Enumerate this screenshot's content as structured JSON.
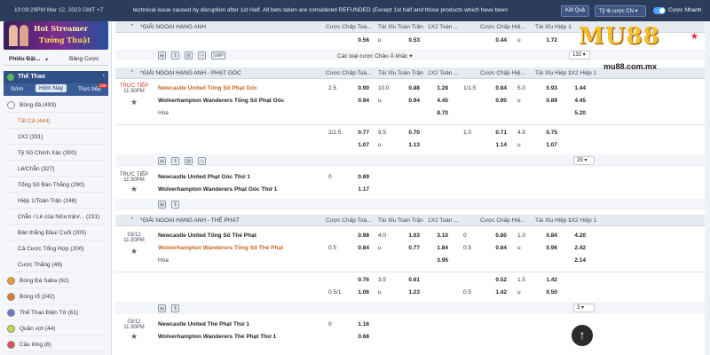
{
  "topbar": {
    "datetime": "10:09:29PM Mar 12, 2023 GMT +7",
    "ticker": "technical issue caused by disruption after 1st Half. All bets taken are considered REFUNDED (Except 1st half and those products which have been",
    "results_button": "Kết Quả",
    "odds_format": "Tỷ lệ cược CN",
    "quick_bet_label": "Cược Nhanh"
  },
  "banner": {
    "line1": "Hot Streamer",
    "line2": "Tưởng Thuật"
  },
  "logo": {
    "brand": "MU88",
    "url": "mu88.com.mx"
  },
  "sidebar": {
    "tabs": [
      "Phiếu Đặt...",
      "Bảng Cược"
    ],
    "sport_header": "Thể Thao",
    "subtabs": [
      "Sớm",
      "Hôm Nay",
      "Trực tiếp"
    ],
    "live_badge": "105",
    "items": [
      {
        "label": "Bóng đá (493)",
        "sport": true
      },
      {
        "label": "Tất Cả (444)",
        "selected": true
      },
      {
        "label": "1X2 (331)"
      },
      {
        "label": "Tỷ Số Chính Xác (300)"
      },
      {
        "label": "Lẻ/Chẵn (327)"
      },
      {
        "label": "Tổng Số Bàn Thắng (290)"
      },
      {
        "label": "Hiệp 1/Toàn Trận (248)"
      },
      {
        "label": "Chẵn / Lẻ của Nửa trận/... (231)"
      },
      {
        "label": "Bàn thắng Đầu/ Cuối (205)"
      },
      {
        "label": "Cả Cược Tổng Hợp (200)"
      },
      {
        "label": "Cược Thắng (49)"
      },
      {
        "label": "Bóng Đá Saba (62)",
        "sport": true
      },
      {
        "label": "Bóng rổ (242)",
        "sport": true
      },
      {
        "label": "Thể Thao Điện Tử (61)",
        "sport": true
      },
      {
        "label": "Quần vợt (44)",
        "sport": true
      },
      {
        "label": "Cầu lông (6)",
        "sport": true
      }
    ]
  },
  "columns": {
    "handicap": "Cược Chấp Toà...",
    "overunder": "Tài Xỉu Toàn Trận",
    "x12": "1X2 Toàn ...",
    "handicap_h1": "Cược Chấp Hiệ...",
    "overunder_h1": "Tài Xỉu Hiệp 1",
    "x12_h1": "1X2 Hiệp 1"
  },
  "league1": {
    "name": "*GIẢI NGOẠI HẠNG ANH",
    "top_partial": {
      "o1": "0.56",
      "u": "u",
      "o2": "0.53",
      "o3": "0.44",
      "u2": "u",
      "o4": "1.72"
    },
    "other_bets": "Các loại cược Châu Á khác",
    "page": "132"
  },
  "league2": {
    "name": "*GIẢI NGOẠI HẠNG ANH - PHẠT GÓC",
    "match": {
      "status": "TRỰC TIẾP",
      "time": "11:30PM",
      "home": "Newcastle United Tổng Số Phạt Góc",
      "away": "Wolverhampton Wanderers Tổng Số Phạt Góc",
      "draw": "Hòa",
      "r1": {
        "hcp": "2.5",
        "h1": "0.90",
        "ou": "10.0",
        "o1": "0.88",
        "x1": "1.28",
        "hcp2": "1/1.5",
        "h2": "0.84",
        "ou2": "5.0",
        "o2": "0.93",
        "x2": "1.44"
      },
      "r2": {
        "h1": "0.94",
        "u": "u",
        "o1": "0.94",
        "x1": "4.45",
        "h2": "0.90",
        "u2": "u",
        "o2": "0.89",
        "x2": "4.45"
      },
      "r3": {
        "x1": "8.70",
        "x2": "5.20"
      },
      "r4": {
        "hcp": "2/2.5",
        "h1": "0.77",
        "ou": "9.5",
        "o1": "0.70",
        "hcp2": "1.0",
        "h2": "0.71",
        "ou2": "4.5",
        "o2": "0.75"
      },
      "r5": {
        "h1": "1.07",
        "u": "u",
        "o1": "1.13",
        "h2": "1.14",
        "u2": "u",
        "o2": "1.07"
      }
    },
    "page": "29"
  },
  "match3": {
    "status": "TRỰC TIẾP",
    "time": "11:30PM",
    "home": "Newcastle United Phạt Góc Thứ 1",
    "away": "Wolverhampton Wanderers Phạt Góc Thứ 1",
    "hcp": "0",
    "h1": "0.69",
    "h2": "1.17"
  },
  "league3": {
    "name": "*GIẢI NGOẠI HẠNG ANH - THẺ PHẠT",
    "match": {
      "date": "03/12",
      "time": "11:30PM",
      "home": "Newcastle United Tổng Số Thẻ Phạt",
      "away": "Wolverhampton Wanderers Tổng Số Thẻ Phạt",
      "draw": "Hòa",
      "r1": {
        "h1": "0.98",
        "ou": "4.0",
        "o1": "1.03",
        "x1": "3.10",
        "hcp2": "0",
        "h2": "0.80",
        "ou2": "1.0",
        "o2": "0.84",
        "x2": "4.20"
      },
      "r2": {
        "hcp": "0.5",
        "h1": "0.84",
        "u": "u",
        "o1": "0.77",
        "x1": "1.84",
        "hcp2": "0.5",
        "h2": "0.84",
        "u2": "u",
        "o2": "0.96",
        "x2": "2.42"
      },
      "r3": {
        "x1": "3.95",
        "x2": "2.14"
      },
      "r4": {
        "h1": "0.76",
        "ou": "3.5",
        "o1": "0.61",
        "h2": "0.52",
        "ou2": "1.5",
        "o2": "1.42"
      },
      "r5": {
        "hcp": "0.5/1",
        "h1": "1.06",
        "u": "u",
        "o1": "1.23",
        "hcp2": "0.5",
        "h2": "1.42",
        "u2": "u",
        "o2": "0.50"
      }
    },
    "page": "3"
  },
  "match5": {
    "date": "03/12",
    "time": "11:30PM",
    "home": "Newcastle United Thẻ Phạt Thứ 1",
    "away": "Wolverhampton Wanderers Thẻ Phạt Thứ 1",
    "hcp": "0",
    "h1": "1.16",
    "h2": "0.68"
  },
  "icons": {
    "smp": "SMP",
    "dollar": "$"
  }
}
